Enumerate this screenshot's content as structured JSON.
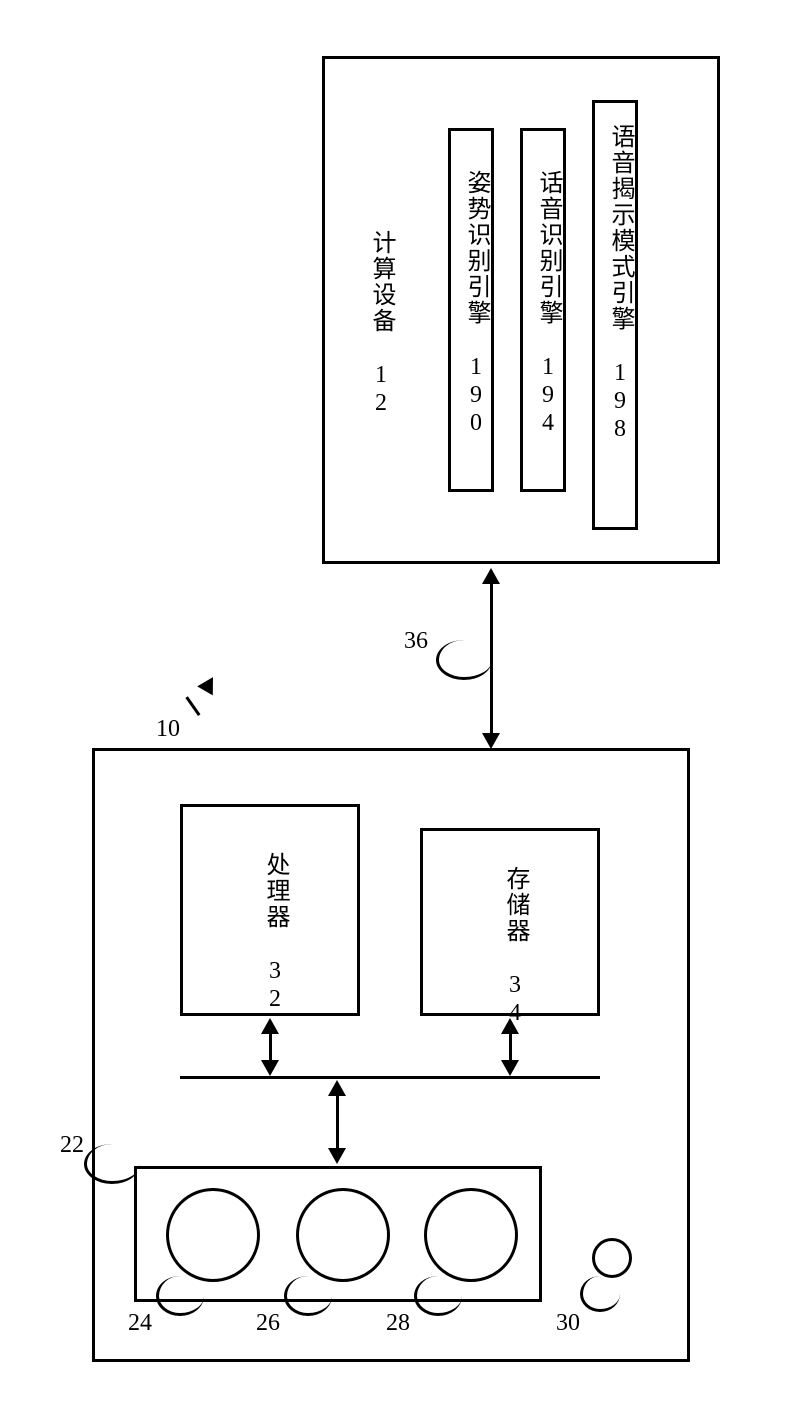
{
  "refs": {
    "system": "10",
    "capture_device": "22",
    "sensor_1": "24",
    "sensor_2": "26",
    "sensor_3": "28",
    "indicator": "30",
    "link": "36"
  },
  "bottom_device": {
    "processor": "处理器 32",
    "memory": "存储器 34"
  },
  "top_device": {
    "title": "计算设备 12",
    "engine_gesture": "姿势识别引擎 190",
    "engine_voice": "话音识别引擎 194",
    "engine_speech_mode": "语音揭示模式引擎 198"
  }
}
